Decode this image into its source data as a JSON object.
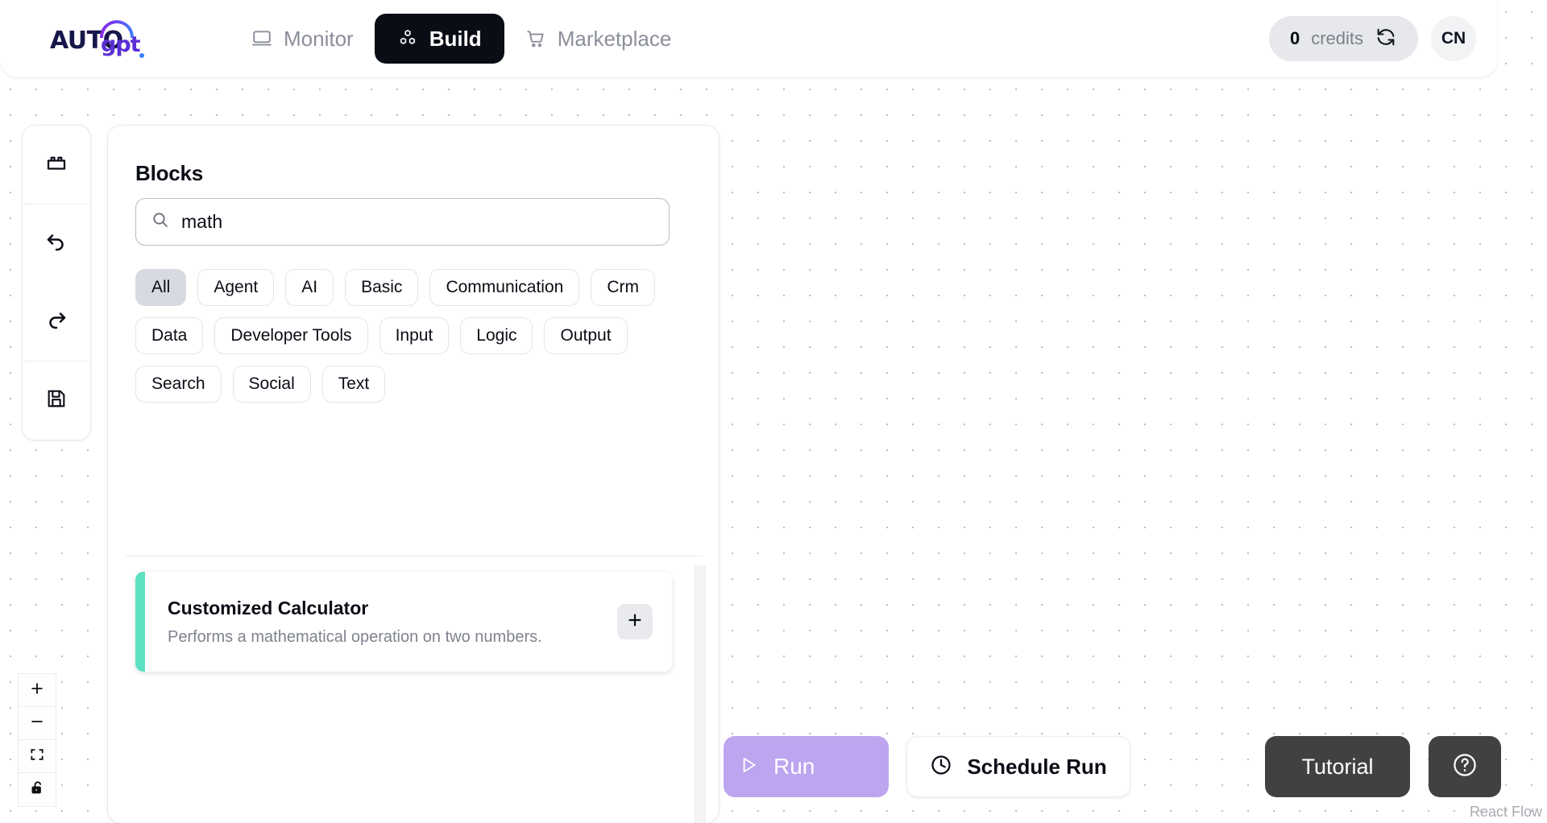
{
  "header": {
    "logo": {
      "primary": "AUTO",
      "secondary": "gpt",
      "icon": "autogpt-logo"
    },
    "nav": [
      {
        "label": "Monitor",
        "icon": "monitor-icon",
        "active": false
      },
      {
        "label": "Build",
        "icon": "blocks-cubes-icon",
        "active": true
      },
      {
        "label": "Marketplace",
        "icon": "shopping-cart-icon",
        "active": false
      }
    ],
    "credits": {
      "value": "0",
      "label": "credits",
      "refresh_icon": "refresh-icon"
    },
    "avatar": {
      "initials": "CN"
    }
  },
  "side_toolbar": {
    "items": [
      {
        "icon": "blocks-icon",
        "name": "blocks-toggle"
      },
      {
        "icon": "undo-icon",
        "name": "undo"
      },
      {
        "icon": "redo-icon",
        "name": "redo"
      },
      {
        "icon": "save-icon",
        "name": "save"
      }
    ]
  },
  "blocks_panel": {
    "title": "Blocks",
    "search": {
      "value": "math",
      "placeholder": "Search blocks",
      "icon": "search-icon"
    },
    "filters": [
      {
        "label": "All",
        "selected": true
      },
      {
        "label": "Agent",
        "selected": false
      },
      {
        "label": "AI",
        "selected": false
      },
      {
        "label": "Basic",
        "selected": false
      },
      {
        "label": "Communication",
        "selected": false
      },
      {
        "label": "Crm",
        "selected": false
      },
      {
        "label": "Data",
        "selected": false
      },
      {
        "label": "Developer Tools",
        "selected": false
      },
      {
        "label": "Input",
        "selected": false
      },
      {
        "label": "Logic",
        "selected": false
      },
      {
        "label": "Output",
        "selected": false
      },
      {
        "label": "Search",
        "selected": false
      },
      {
        "label": "Social",
        "selected": false
      },
      {
        "label": "Text",
        "selected": false
      }
    ],
    "results": [
      {
        "name": "Customized Calculator",
        "description": "Performs a mathematical operation on two numbers.",
        "accent_color": "#5ee0c3",
        "add_icon": "plus-icon"
      }
    ]
  },
  "canvas_controls": {
    "zoom_in": {
      "icon": "plus-icon"
    },
    "zoom_out": {
      "icon": "minus-icon"
    },
    "fit_view": {
      "icon": "fit-view-icon"
    },
    "lock": {
      "icon": "unlock-icon"
    }
  },
  "actions": {
    "run": {
      "label": "Run",
      "icon": "play-icon",
      "color": "#bda5ef"
    },
    "schedule": {
      "label": "Schedule Run",
      "icon": "clock-icon"
    },
    "tutorial": {
      "label": "Tutorial",
      "color": "#414141"
    },
    "help": {
      "icon": "question-circle-icon"
    }
  },
  "attribution": {
    "label": "React Flow"
  }
}
